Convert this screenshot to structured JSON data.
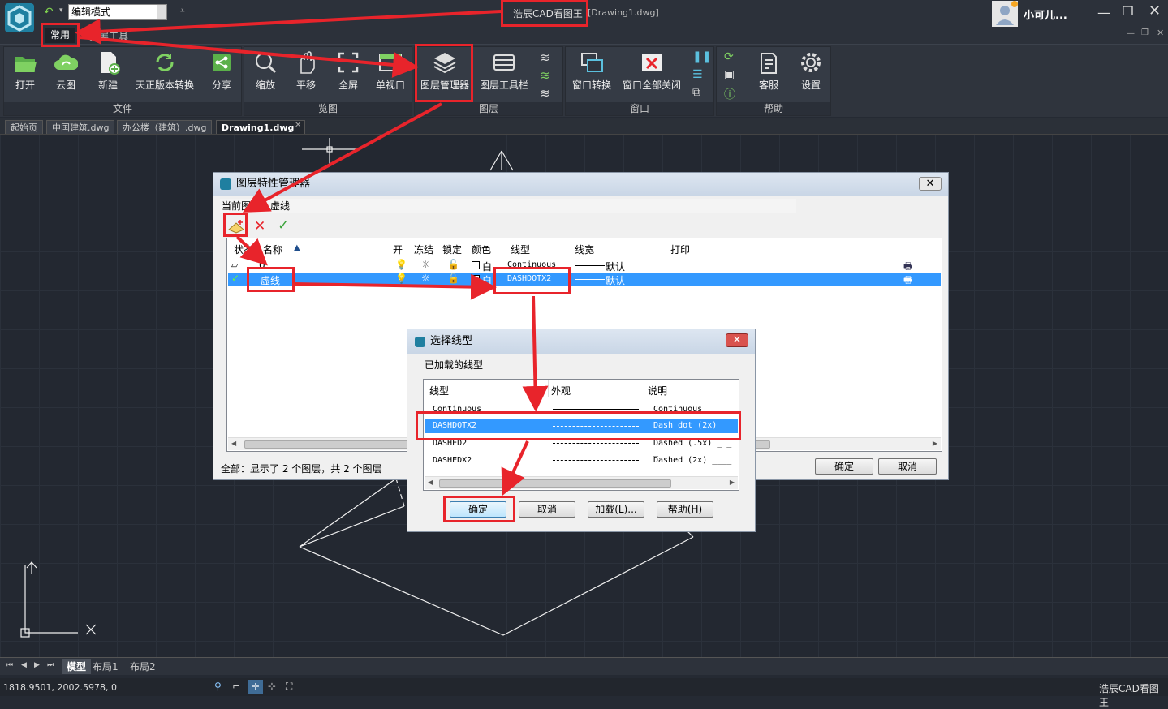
{
  "title": {
    "brand": "浩辰CAD看图王",
    "doc": "[Drawing1.dwg]",
    "mode": "编辑模式",
    "user": "小可儿..."
  },
  "menu": {
    "tab_common": "常用",
    "tab_other": "扩展工具"
  },
  "ribbon": {
    "file": {
      "label": "文件",
      "open": "打开",
      "cloud": "云图",
      "new": "新建",
      "convert": "天正版本转换",
      "share": "分享"
    },
    "view": {
      "label": "览图",
      "zoom": "缩放",
      "pan": "平移",
      "full": "全屏",
      "single": "单视口"
    },
    "layer": {
      "label": "图层",
      "manager": "图层管理器",
      "toolbar": "图层工具栏"
    },
    "window": {
      "label": "窗口",
      "switch": "窗口转换",
      "close_all": "窗口全部关闭"
    },
    "help": {
      "label": "帮助",
      "service": "客服",
      "settings": "设置"
    }
  },
  "doc_tabs": [
    "起始页",
    "中国建筑.dwg",
    "办公楼（建筑）.dwg",
    "Drawing1.dwg"
  ],
  "layer_dialog": {
    "title": "图层特性管理器",
    "current_label": "当前图层：虚线",
    "columns": [
      "状态",
      "名称",
      "开",
      "冻结",
      "锁定",
      "颜色",
      "线型",
      "线宽",
      "打印"
    ],
    "rows": [
      {
        "name": "0",
        "color": "白",
        "linetype": "Continuous",
        "lineweight": "默认"
      },
      {
        "name": "虚线",
        "color": "白",
        "linetype": "DASHDOTX2",
        "lineweight": "默认"
      }
    ],
    "footer": "全部：显示了 2 个图层，共 2 个图层",
    "ok": "确定",
    "cancel": "取消"
  },
  "linetype_dialog": {
    "title": "选择线型",
    "loaded_label": "已加载的线型",
    "columns": [
      "线型",
      "外观",
      "说明"
    ],
    "rows": [
      {
        "name": "Continuous",
        "desc": "Continuous"
      },
      {
        "name": "DASHDOTX2",
        "desc": "Dash dot (2x) ____"
      },
      {
        "name": "DASHED2",
        "desc": "Dashed (.5x) _ _ _"
      },
      {
        "name": "DASHEDX2",
        "desc": "Dashed (2x) ____"
      }
    ],
    "buttons": {
      "ok": "确定",
      "cancel": "取消",
      "load": "加载(L)...",
      "help": "帮助(H)"
    }
  },
  "layout_tabs": [
    "模型",
    "布局1",
    "布局2"
  ],
  "status": {
    "coords": "1818.9501, 2002.5978, 0",
    "brand": "浩辰CAD看图王"
  },
  "colors": {
    "accent_red": "#e8242b",
    "selection_blue": "#3399ff"
  }
}
